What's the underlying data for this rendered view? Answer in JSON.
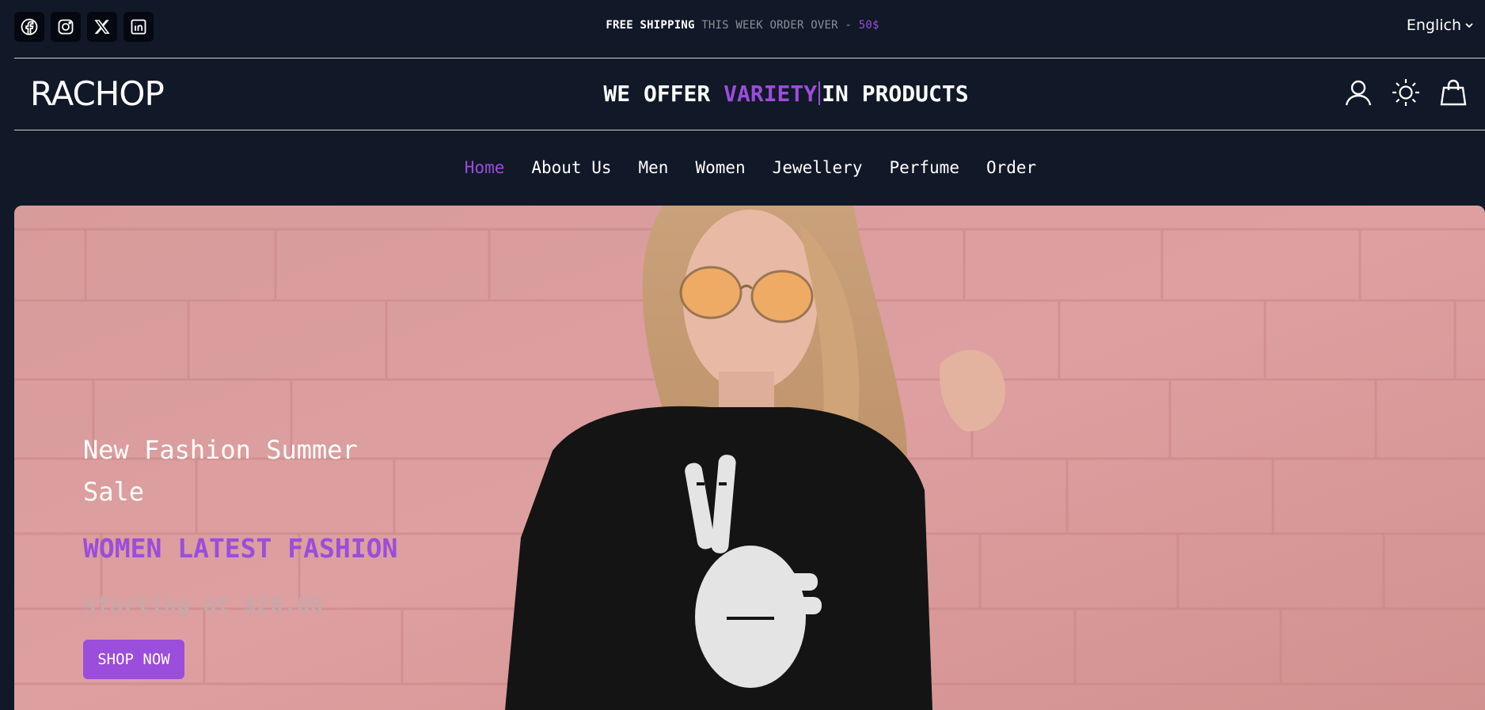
{
  "topbar": {
    "socials": [
      {
        "icon": "facebook-icon"
      },
      {
        "icon": "instagram-icon"
      },
      {
        "icon": "x-icon"
      },
      {
        "icon": "linkedin-icon"
      }
    ],
    "shipping_strong": "FREE SHIPPING",
    "shipping_text": "THIS WEEK ORDER OVER - ",
    "shipping_amount": "50$",
    "language": "Englich"
  },
  "header": {
    "logo": "RACHOP",
    "tagline_before": "WE OFFER ",
    "tagline_highlight": "VARIETY",
    "tagline_after": "IN PRODUCTS"
  },
  "nav": {
    "items": [
      {
        "label": "Home",
        "active": true
      },
      {
        "label": "About Us"
      },
      {
        "label": "Men"
      },
      {
        "label": "Women"
      },
      {
        "label": "Jewellery"
      },
      {
        "label": "Perfume"
      },
      {
        "label": "Order"
      }
    ]
  },
  "hero": {
    "title": "New Fashion Summer Sale",
    "subtitle": "WOMEN LATEST FASHION",
    "price": "starting at $20.00",
    "button": "SHOP NOW"
  },
  "colors": {
    "background": "#111827",
    "accent": "#9b4ddb",
    "hero_wall": "#d69a98"
  }
}
